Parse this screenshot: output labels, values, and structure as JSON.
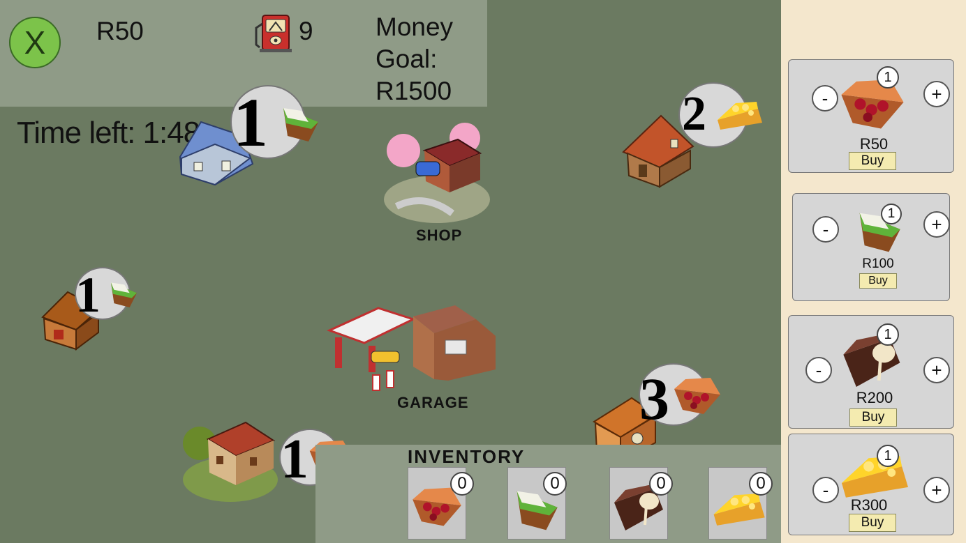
{
  "hud": {
    "close_label": "X",
    "money": "R50",
    "fuel_count": "9",
    "goal_line1": "Money",
    "goal_line2": "Goal:",
    "goal_line3": "R1500",
    "timer": "Time left: 1:48"
  },
  "map": {
    "shop_label": "SHOP",
    "garage_label": "GARAGE",
    "orders": [
      {
        "qty": "1",
        "pie": "key-lime-pie-icon"
      },
      {
        "qty": "2",
        "pie": "lemon-pie-icon"
      },
      {
        "qty": "1",
        "pie": "key-lime-pie-icon"
      },
      {
        "qty": "3",
        "pie": "cherry-pie-icon"
      },
      {
        "qty": "1",
        "pie": "cherry-pie-icon"
      }
    ]
  },
  "inventory": {
    "title": "INVENTORY",
    "slots": [
      {
        "pie": "cherry-pie-icon",
        "count": "0"
      },
      {
        "pie": "key-lime-pie-icon",
        "count": "0"
      },
      {
        "pie": "chocolate-pie-icon",
        "count": "0"
      },
      {
        "pie": "lemon-pie-icon",
        "count": "0"
      }
    ]
  },
  "shop": {
    "items": [
      {
        "pie": "cherry-pie-icon",
        "qty": "1",
        "price": "R50",
        "buy_label": "Buy",
        "minus": "-",
        "plus": "+"
      },
      {
        "pie": "key-lime-pie-icon",
        "qty": "1",
        "price": "R100",
        "buy_label": "Buy",
        "minus": "-",
        "plus": "+"
      },
      {
        "pie": "chocolate-pie-icon",
        "qty": "1",
        "price": "R200",
        "buy_label": "Buy",
        "minus": "-",
        "plus": "+"
      },
      {
        "pie": "lemon-pie-icon",
        "qty": "1",
        "price": "R300",
        "buy_label": "Buy",
        "minus": "-",
        "plus": "+"
      }
    ]
  },
  "colors": {
    "map_bg": "#6b7a61",
    "panel_bg": "#f4e7cd",
    "close_green": "#7cc34a",
    "buy_bg": "#f4ebb0"
  }
}
